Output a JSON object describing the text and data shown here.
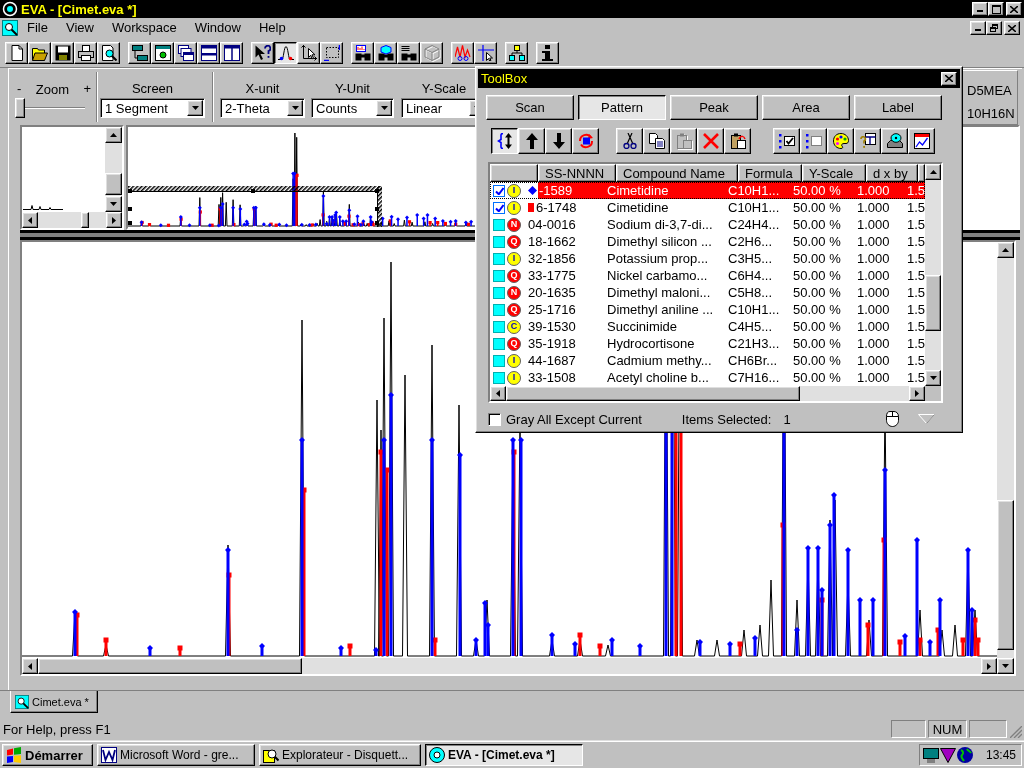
{
  "window": {
    "title": "EVA - [Cimet.eva *]"
  },
  "menu": {
    "items": [
      "File",
      "View",
      "Workspace",
      "Window",
      "Help"
    ]
  },
  "toolbar": {
    "groups": [
      [
        {
          "kind": "new",
          "pressed": false,
          "disabled": false
        },
        {
          "kind": "open",
          "pressed": false,
          "disabled": false
        },
        {
          "kind": "save",
          "pressed": false,
          "disabled": false
        },
        {
          "kind": "print",
          "pressed": false,
          "disabled": false
        },
        {
          "kind": "preview",
          "pressed": false,
          "disabled": false
        }
      ],
      [
        {
          "kind": "linkedboxes",
          "pressed": false,
          "disabled": false
        },
        {
          "kind": "windowcircle",
          "pressed": false,
          "disabled": false
        },
        {
          "kind": "cascade",
          "pressed": false,
          "disabled": false
        },
        {
          "kind": "tilerows",
          "pressed": false,
          "disabled": false
        },
        {
          "kind": "tilecols",
          "pressed": false,
          "disabled": false
        }
      ],
      [
        {
          "kind": "helppointer",
          "pressed": false,
          "disabled": false
        },
        {
          "kind": "peakcurve",
          "pressed": true,
          "disabled": false
        },
        {
          "kind": "axispointer",
          "pressed": false,
          "disabled": false
        },
        {
          "kind": "dottedframe",
          "pressed": false,
          "disabled": false
        }
      ],
      [
        {
          "kind": "findpattern",
          "pressed": false,
          "disabled": false
        },
        {
          "kind": "findcube",
          "pressed": false,
          "disabled": false
        },
        {
          "kind": "findlist",
          "pressed": false,
          "disabled": false
        },
        {
          "kind": "cube",
          "pressed": false,
          "disabled": true
        }
      ],
      [
        {
          "kind": "peakcut",
          "pressed": false,
          "disabled": false
        },
        {
          "kind": "crosshair",
          "pressed": false,
          "disabled": false
        }
      ],
      [
        {
          "kind": "hierarchy",
          "pressed": false,
          "disabled": false
        }
      ],
      [
        {
          "kind": "info",
          "pressed": false,
          "disabled": false
        }
      ]
    ]
  },
  "controls": {
    "zoom": {
      "minus": "-",
      "label": "Zoom",
      "plus": "+",
      "level": 0
    },
    "dropdowns": [
      {
        "label": "Screen",
        "value": "1 Segment"
      },
      {
        "label": "X-unit",
        "value": "2-Theta"
      },
      {
        "label": "Y-Unit",
        "value": "Counts"
      },
      {
        "label": "Y-Scale",
        "value": "Linear"
      }
    ],
    "info_panel": {
      "lines": [
        "D5MEA",
        "10H16N"
      ]
    }
  },
  "toolbox": {
    "title": "ToolBox",
    "tabs": [
      {
        "label": "Scan",
        "selected": false
      },
      {
        "label": "Pattern",
        "selected": true
      },
      {
        "label": "Peak",
        "selected": false
      },
      {
        "label": "Area",
        "selected": false
      },
      {
        "label": "Label",
        "selected": false
      }
    ],
    "tools": [
      [
        {
          "kind": "bracearrows",
          "pressed": true,
          "disabled": false
        },
        {
          "kind": "up",
          "pressed": false,
          "disabled": false
        },
        {
          "kind": "down",
          "pressed": false,
          "disabled": false
        },
        {
          "kind": "swap",
          "pressed": false,
          "disabled": false
        }
      ],
      [
        {
          "kind": "cut",
          "pressed": false,
          "disabled": false
        },
        {
          "kind": "copy",
          "pressed": false,
          "disabled": false
        },
        {
          "kind": "paste",
          "pressed": false,
          "disabled": true
        },
        {
          "kind": "delete",
          "pressed": false,
          "disabled": false
        },
        {
          "kind": "pastespecial",
          "pressed": false,
          "disabled": false
        }
      ],
      [
        {
          "kind": "markall",
          "pressed": false,
          "disabled": false
        },
        {
          "kind": "unmarkall",
          "pressed": false,
          "disabled": false
        },
        {
          "kind": "palette",
          "pressed": false,
          "disabled": false
        },
        {
          "kind": "tablehelp",
          "pressed": false,
          "disabled": false
        },
        {
          "kind": "disk",
          "pressed": false,
          "disabled": false
        },
        {
          "kind": "chartwindow",
          "pressed": false,
          "disabled": false
        }
      ]
    ],
    "table": {
      "columns": [
        "SS-NNNN",
        "Compound Name",
        "Formula",
        "Y-Scale",
        "d x by"
      ],
      "rows": [
        {
          "checked": true,
          "quality": {
            "letter": "I",
            "color": "#ffff00"
          },
          "marker": {
            "kind": "diamond",
            "color": "#0000ff"
          },
          "number": "-1589",
          "compound_name": "Cimetidine",
          "formula": "C10H1...",
          "y_scale": "50.00 %",
          "d_x_by": "1.000",
          "column_7": "1.5",
          "selected": true
        },
        {
          "checked": true,
          "quality": {
            "letter": "I",
            "color": "#ffff00"
          },
          "marker": {
            "kind": "square",
            "color": "#ff0000"
          },
          "number": "6-1748",
          "compound_name": "Cimetidine",
          "formula": "C10H1...",
          "y_scale": "50.00 %",
          "d_x_by": "1.000",
          "column_7": "1.5",
          "selected": false
        },
        {
          "checked": false,
          "quality": {
            "letter": "N",
            "color": "#ff0000"
          },
          "number": "04-0016",
          "compound_name": "Sodium di-3,7-di...",
          "formula": "C24H4...",
          "y_scale": "50.00 %",
          "d_x_by": "1.000",
          "column_7": "1.5",
          "selected": false
        },
        {
          "checked": false,
          "quality": {
            "letter": "Q",
            "color": "#ff0000"
          },
          "number": "18-1662",
          "compound_name": "Dimethyl silicon ...",
          "formula": "C2H6...",
          "y_scale": "50.00 %",
          "d_x_by": "1.000",
          "column_7": "1.5",
          "selected": false
        },
        {
          "checked": false,
          "quality": {
            "letter": "I",
            "color": "#ffff00"
          },
          "number": "32-1856",
          "compound_name": "Potassium prop...",
          "formula": "C3H5...",
          "y_scale": "50.00 %",
          "d_x_by": "1.000",
          "column_7": "1.5",
          "selected": false
        },
        {
          "checked": false,
          "quality": {
            "letter": "Q",
            "color": "#ff0000"
          },
          "number": "33-1775",
          "compound_name": "Nickel carbamo...",
          "formula": "C6H4...",
          "y_scale": "50.00 %",
          "d_x_by": "1.000",
          "column_7": "1.5",
          "selected": false
        },
        {
          "checked": false,
          "quality": {
            "letter": "N",
            "color": "#ff0000"
          },
          "number": "20-1635",
          "compound_name": "Dimethyl maloni...",
          "formula": "C5H8...",
          "y_scale": "50.00 %",
          "d_x_by": "1.000",
          "column_7": "1.5",
          "selected": false
        },
        {
          "checked": false,
          "quality": {
            "letter": "Q",
            "color": "#ff0000"
          },
          "number": "25-1716",
          "compound_name": "Dimethyl aniline ...",
          "formula": "C10H1...",
          "y_scale": "50.00 %",
          "d_x_by": "1.000",
          "column_7": "1.5",
          "selected": false
        },
        {
          "checked": false,
          "quality": {
            "letter": "C",
            "color": "#ffff00"
          },
          "number": "39-1530",
          "compound_name": "Succinimide",
          "formula": "C4H5...",
          "y_scale": "50.00 %",
          "d_x_by": "1.000",
          "column_7": "1.5",
          "selected": false
        },
        {
          "checked": false,
          "quality": {
            "letter": "Q",
            "color": "#ff0000"
          },
          "number": "35-1918",
          "compound_name": "Hydrocortisone",
          "formula": "C21H3...",
          "y_scale": "50.00 %",
          "d_x_by": "1.000",
          "column_7": "1.5",
          "selected": false
        },
        {
          "checked": false,
          "quality": {
            "letter": "I",
            "color": "#ffff00"
          },
          "number": "44-1687",
          "compound_name": "Cadmium methy...",
          "formula": "CH6Br...",
          "y_scale": "50.00 %",
          "d_x_by": "1.000",
          "column_7": "1.5",
          "selected": false
        },
        {
          "checked": false,
          "quality": {
            "letter": "I",
            "color": "#ffff00"
          },
          "number": "33-1508",
          "compound_name": "Acetyl choline b...",
          "formula": "C7H16...",
          "y_scale": "50.00 %",
          "d_x_by": "1.000",
          "column_7": "1.5",
          "selected": false
        }
      ]
    },
    "gray_all_except_current": {
      "label": "Gray All Except Current",
      "checked": false
    },
    "items_selected": {
      "label": "Items Selected:",
      "value": "1"
    }
  },
  "document_tabs": [
    {
      "label": "Cimet.eva *",
      "selected": true
    }
  ],
  "status_bar": {
    "message": "For Help, press F1",
    "indicators": [
      "NUM"
    ]
  },
  "taskbar": {
    "start": "Démarrer",
    "tasks": [
      {
        "kind": "word",
        "label": "Microsoft Word - gre...",
        "selected": false
      },
      {
        "kind": "explorer",
        "label": "Explorateur - Disquett...",
        "selected": false
      },
      {
        "kind": "eva",
        "label": "EVA - [Cimet.eva *]",
        "selected": true
      }
    ],
    "clock": "13:45"
  }
}
